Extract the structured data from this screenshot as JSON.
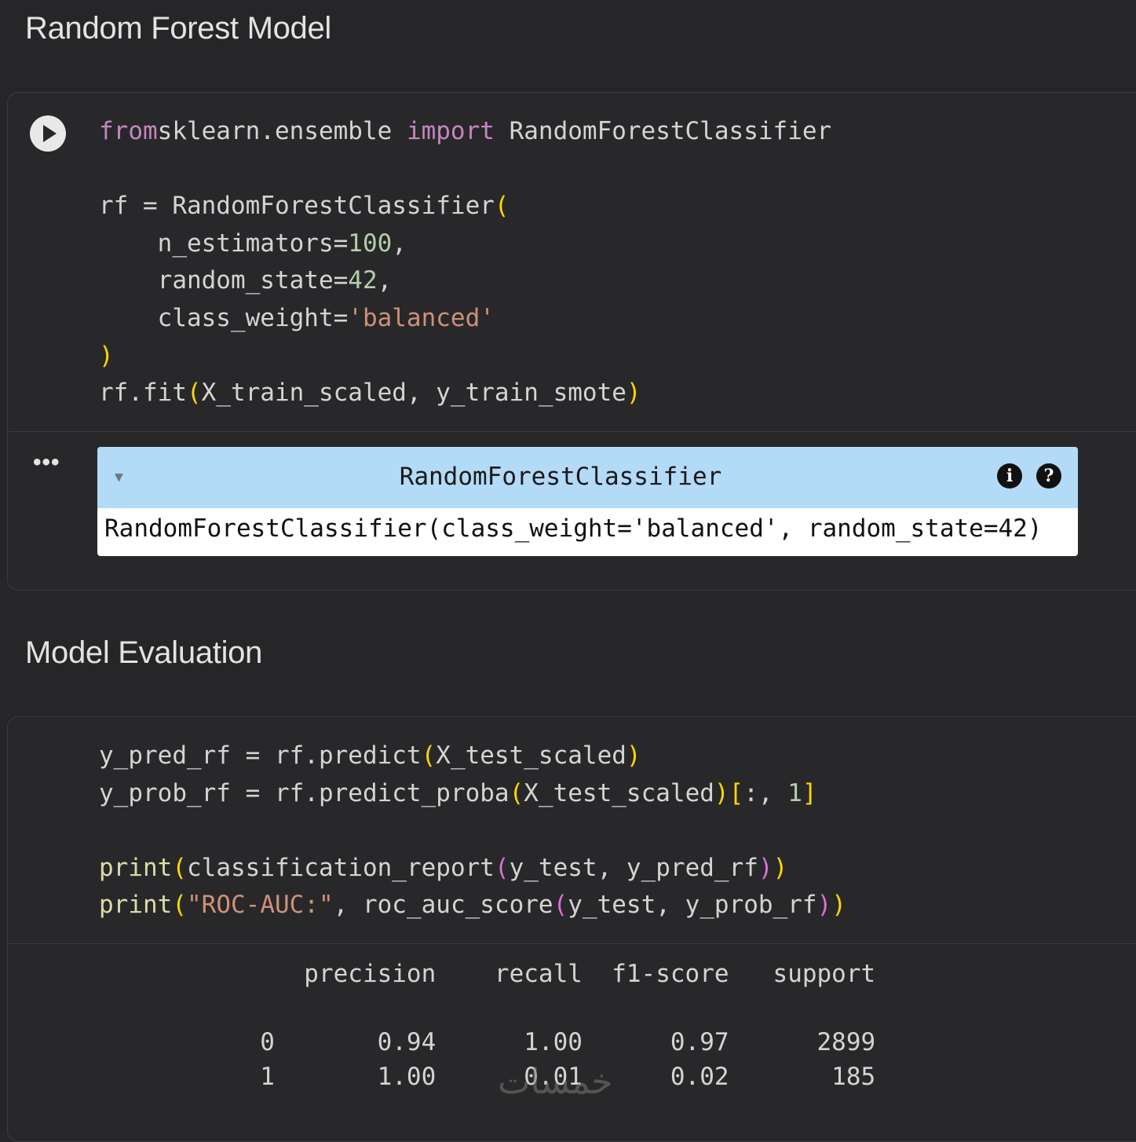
{
  "section1": {
    "heading": "Random Forest Model"
  },
  "cell1": {
    "code": [
      [
        [
          "kw",
          "from"
        ],
        [
          "",
          "sklearn.ensemble "
        ],
        [
          "kw",
          "import"
        ],
        [
          "",
          " RandomForestClassifier"
        ]
      ],
      [],
      [
        [
          "",
          "rf = RandomForestClassifier"
        ],
        [
          "p1",
          "("
        ]
      ],
      [
        [
          "",
          "    n_estimators="
        ],
        [
          "num",
          "100"
        ],
        [
          "",
          ","
        ]
      ],
      [
        [
          "",
          "    random_state="
        ],
        [
          "num",
          "42"
        ],
        [
          "",
          ","
        ]
      ],
      [
        [
          "",
          "    class_weight="
        ],
        [
          "str",
          "'balanced'"
        ]
      ],
      [
        [
          "p1",
          ")"
        ]
      ],
      [
        [
          "",
          "rf.fit"
        ],
        [
          "p1",
          "("
        ],
        [
          "",
          "X_train_scaled, y_train_smote"
        ],
        [
          "p1",
          ")"
        ]
      ]
    ],
    "output": {
      "toggle": "▼",
      "title": "RandomForestClassifier",
      "info_icon": "i",
      "help_icon": "?",
      "repr": "RandomForestClassifier(class_weight='balanced', random_state=42)"
    },
    "ellipsis": "•••"
  },
  "section2": {
    "heading": "Model Evaluation"
  },
  "cell2": {
    "code": [
      [
        [
          "",
          "y_pred_rf = rf.predict"
        ],
        [
          "p1",
          "("
        ],
        [
          "",
          "X_test_scaled"
        ],
        [
          "p1",
          ")"
        ]
      ],
      [
        [
          "",
          "y_prob_rf = rf.predict_proba"
        ],
        [
          "p1",
          "("
        ],
        [
          "",
          "X_test_scaled"
        ],
        [
          "p1",
          ")"
        ],
        [
          "p1",
          "["
        ],
        [
          "",
          ":, "
        ],
        [
          "num",
          "1"
        ],
        [
          "p1",
          "]"
        ]
      ],
      [],
      [
        [
          "fn",
          "print"
        ],
        [
          "p1",
          "("
        ],
        [
          "",
          "classification_report"
        ],
        [
          "p2",
          "("
        ],
        [
          "",
          "y_test, y_pred_rf"
        ],
        [
          "p2",
          ")"
        ],
        [
          "p1",
          ")"
        ]
      ],
      [
        [
          "fn",
          "print"
        ],
        [
          "p1",
          "("
        ],
        [
          "str",
          "\"ROC-AUC:\""
        ],
        [
          "",
          ", roc_auc_score"
        ],
        [
          "p2",
          "("
        ],
        [
          "",
          "y_test, y_prob_rf"
        ],
        [
          "p2",
          ")"
        ],
        [
          "p1",
          ")"
        ]
      ]
    ],
    "report": "              precision    recall  f1-score   support\n\n           0       0.94      1.00      0.97      2899\n           1       1.00      0.01      0.02       185"
  },
  "watermark": "خمسات"
}
